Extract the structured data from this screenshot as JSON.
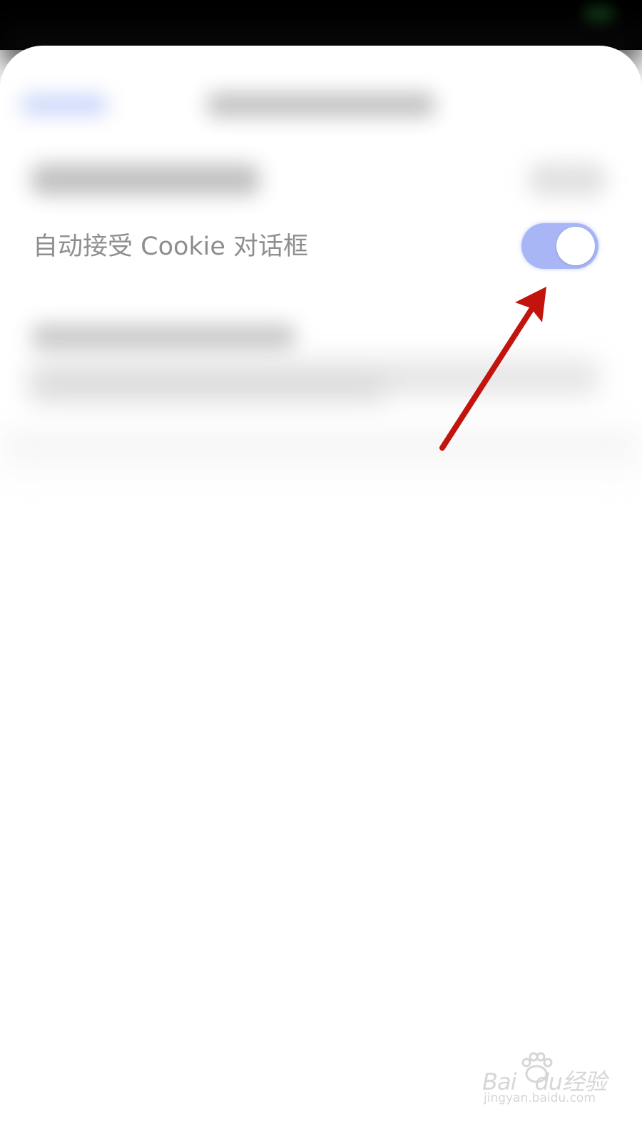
{
  "setting_row": {
    "label": "自动接受 Cookie 对话框",
    "toggle_state": "on"
  },
  "colors": {
    "toggle_on": "#a9b6f6",
    "arrow": "#c2140c",
    "label_text": "#8e8e8e"
  },
  "annotation": {
    "icon": "red-arrow-icon",
    "points_to": "auto-accept-cookie-toggle"
  },
  "watermark": {
    "logo": "Bai",
    "logo_suffix": "du经验",
    "url": "jingyan.baidu.com"
  }
}
